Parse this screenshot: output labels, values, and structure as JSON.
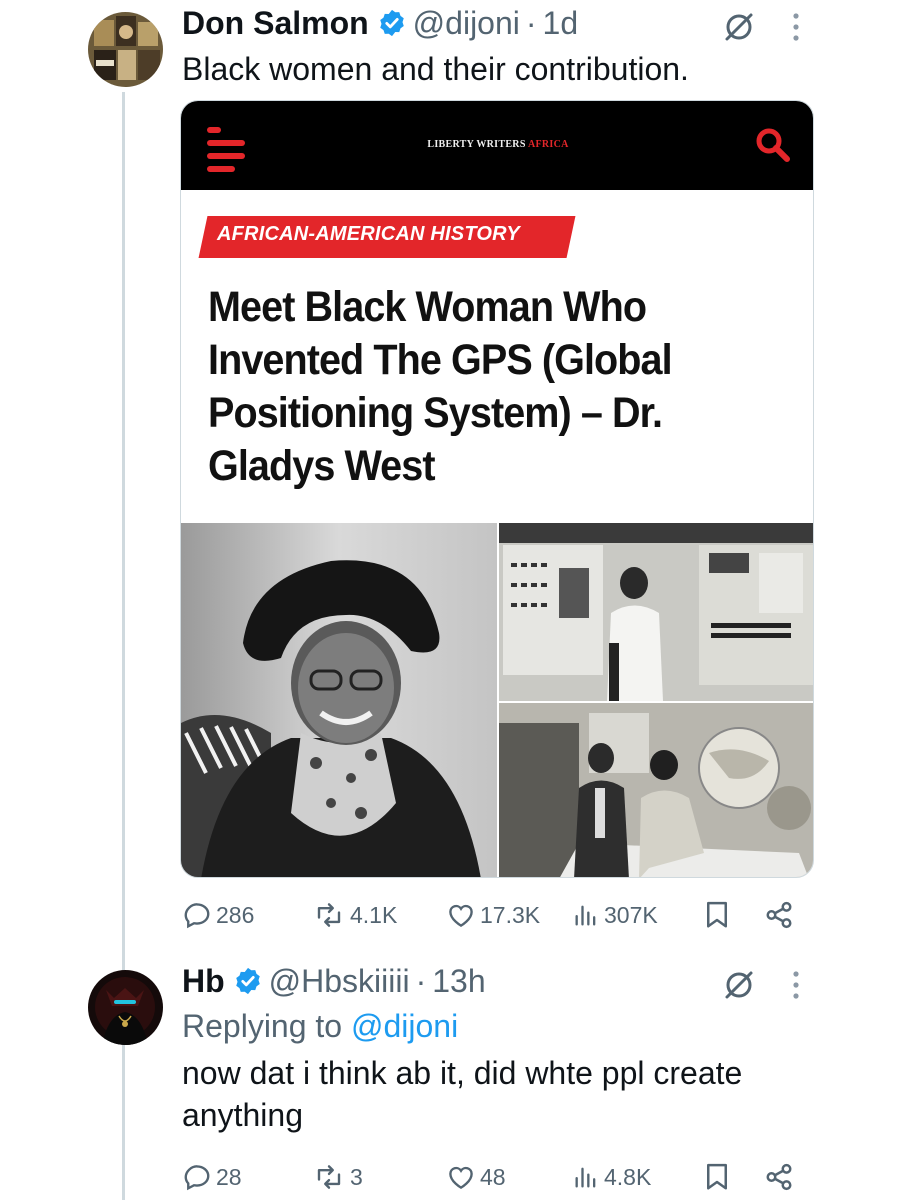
{
  "tweets": [
    {
      "display_name": "Don Salmon",
      "handle": "@dijoni",
      "separator": "·",
      "time": "1d",
      "text": "Black women and their contribution.",
      "media": {
        "site_name_prefix": "LIBERTY WRITERS ",
        "site_name_accent": "AFRICA",
        "category": "AFRICAN-AMERICAN HISTORY",
        "headline": "Meet Black Woman Who Invented The GPS (Global Positioning System) – Dr. Gladys West"
      },
      "stats": {
        "replies": "286",
        "reposts": "4.1K",
        "likes": "17.3K",
        "views": "307K"
      }
    },
    {
      "display_name": "Hb",
      "handle": "@Hbskiiiii",
      "separator": "·",
      "time": "13h",
      "replying_prefix": "Replying to ",
      "replying_to": "@dijoni",
      "text": "now dat i think ab it, did whte ppl create anything",
      "stats": {
        "replies": "28",
        "reposts": "3",
        "likes": "48",
        "views": "4.8K"
      }
    }
  ],
  "colors": {
    "verified": "#1d9bf0",
    "brand_red": "#e3262a",
    "muted": "#536471"
  },
  "icons": [
    "verified-badge-icon",
    "grok-icon",
    "more-icon",
    "reply-icon",
    "repost-icon",
    "like-icon",
    "views-icon",
    "bookmark-icon",
    "share-icon",
    "menu-icon",
    "search-icon"
  ]
}
